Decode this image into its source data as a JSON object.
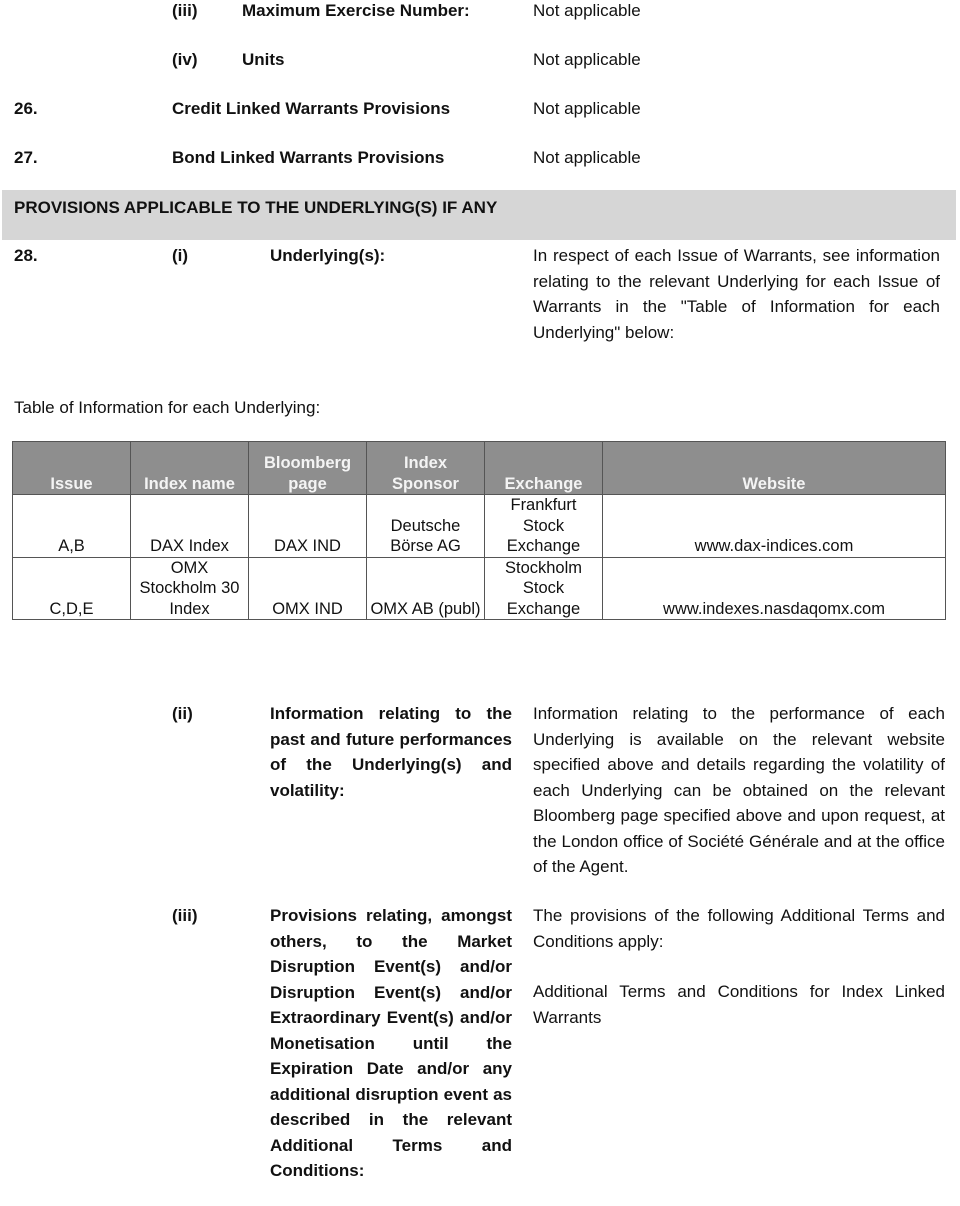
{
  "items_top": [
    {
      "num": "",
      "sub": "(iii)",
      "label": "Maximum Exercise Number:",
      "value": "Not applicable"
    },
    {
      "num": "",
      "sub": "(iv)",
      "label": "Units",
      "value": "Not applicable"
    },
    {
      "num": "26.",
      "sub": "",
      "label": "Credit Linked Warrants Provisions",
      "value": "Not applicable"
    },
    {
      "num": "27.",
      "sub": "",
      "label": "Bond Linked Warrants Provisions",
      "value": "Not applicable"
    }
  ],
  "section_band": "PROVISIONS APPLICABLE TO THE UNDERLYING(S) IF ANY",
  "item28": {
    "num": "28.",
    "sub": "(i)",
    "label": "Underlying(s):",
    "value": "In respect of each Issue of Warrants, see information relating to the relevant Underlying for each Issue of Warrants in the \"Table of Information for each Underlying\" below:"
  },
  "table_caption": "Table of Information for each Underlying:",
  "table": {
    "headers": [
      "Issue",
      "Index name",
      "Bloomberg page",
      "Index Sponsor",
      "Exchange",
      "Website"
    ],
    "rows": [
      [
        "A,B",
        "DAX Index",
        "DAX IND",
        "Deutsche Börse AG",
        "Frankfurt Stock Exchange",
        "www.dax-indices.com"
      ],
      [
        "C,D,E",
        "OMX Stockholm 30 Index",
        "OMX IND",
        "OMX AB (publ)",
        "Stockholm Stock Exchange",
        "www.indexes.nasdaqomx.com"
      ]
    ]
  },
  "item_ii": {
    "sub": "(ii)",
    "label": "Information relating to the past and future performances of the Underlying(s) and volatility:",
    "value": "Information relating to the performance of each Underlying is available on the relevant website specified above and details regarding the volatility of each Underlying can be obtained on the relevant Bloomberg page specified above and upon request, at the London office of Société Générale and at the office of the Agent."
  },
  "item_iii": {
    "sub": "(iii)",
    "label": "Provisions relating, amongst others, to the Market Disruption Event(s) and/or Disruption Event(s) and/or Extraordinary Event(s) and/or Monetisation until the Expiration Date and/or any additional disruption event as described in the relevant Additional Terms and Conditions:",
    "value_1": "The provisions of the following Additional Terms and Conditions apply:",
    "value_2": "Additional Terms and Conditions for Index Linked Warrants"
  }
}
